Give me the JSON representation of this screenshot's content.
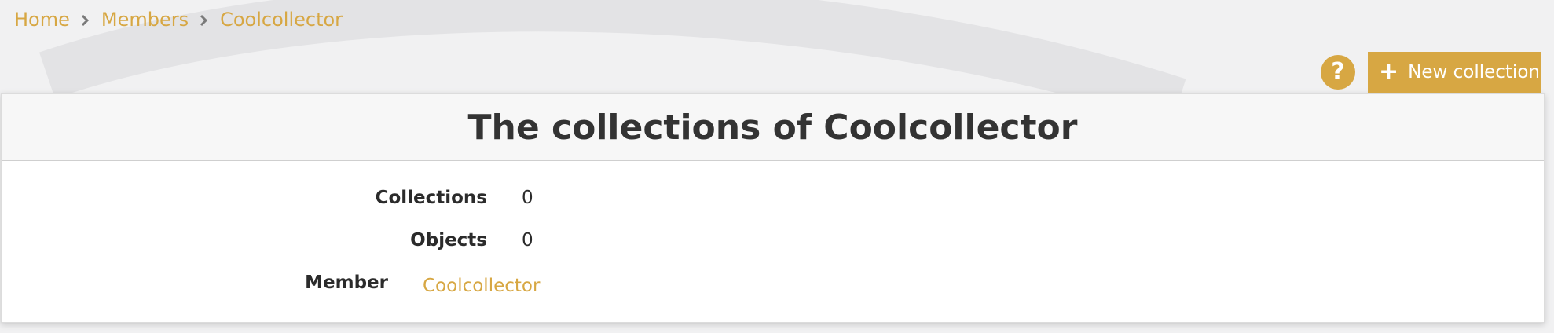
{
  "breadcrumb": {
    "items": [
      {
        "label": "Home"
      },
      {
        "label": "Members"
      },
      {
        "label": "Coolcollector"
      }
    ]
  },
  "toolbar": {
    "help_label": "?",
    "new_collection_icon": "+",
    "new_collection_label": "New collection"
  },
  "page": {
    "title": "The collections of Coolcollector"
  },
  "stats": {
    "collections_label": "Collections",
    "collections_value": "0",
    "objects_label": "Objects",
    "objects_value": "0",
    "member_label": "Member",
    "member_value": "Coolcollector"
  },
  "colors": {
    "accent": "#d7a743",
    "text": "#2b2b2b",
    "background": "#f1f1f2"
  }
}
